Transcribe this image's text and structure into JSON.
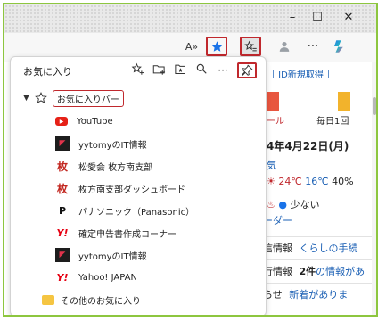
{
  "window": {
    "minimize": "–",
    "maximize": "☐",
    "close": "✕"
  },
  "toolbar": {
    "read_aloud": "A»",
    "more": "···"
  },
  "pane": {
    "title": "お気に入り",
    "more": "···",
    "bar_folder": "お気に入りバー",
    "items": [
      {
        "label": "YouTube",
        "icon": "youtube-icon",
        "glyph": "▶"
      },
      {
        "label": "yytomyのIT情報",
        "icon": "yytomy-icon",
        "glyph": "◤"
      },
      {
        "label": "松愛会 枚方南支部",
        "icon": "kanji-mai-icon",
        "glyph": "枚"
      },
      {
        "label": "枚方南支部ダッシュボード",
        "icon": "kanji-mai-icon",
        "glyph": "枚"
      },
      {
        "label": "パナソニック（Panasonic）",
        "icon": "panasonic-p-icon",
        "glyph": "P"
      },
      {
        "label": "確定申告書作成コーナー",
        "icon": "yahoo-y-icon",
        "glyph": "Y!"
      },
      {
        "label": "yytomyのIT情報",
        "icon": "yytomy-icon",
        "glyph": "◤"
      },
      {
        "label": "Yahoo! JAPAN",
        "icon": "yahoo-y-icon",
        "glyph": "Y!"
      }
    ],
    "other_folder": "その他のお気に入り"
  },
  "background_page": {
    "id_link": "［ ID新規取得 ］",
    "tile_label_1": "ール",
    "tile_label_2": "毎日1回",
    "date": "4年4月22日(月)",
    "weather": "気",
    "temp_high": "24℃",
    "temp_low": "16℃",
    "precip": "40%",
    "pollen_level": "少ない",
    "link_der": "ーダー",
    "info1_a": "信情報",
    "info1_b": "くらしの手続",
    "info2_a": "行情報",
    "info2_count": "2件",
    "info2_b": "の情報があ",
    "info3_a": "らせ",
    "info3_b": "新着がありま"
  },
  "colors": {
    "frame": "#8dc63f",
    "highlight": "#c0282d",
    "star_active": "#1a73e8",
    "link": "#1a5fb4"
  }
}
